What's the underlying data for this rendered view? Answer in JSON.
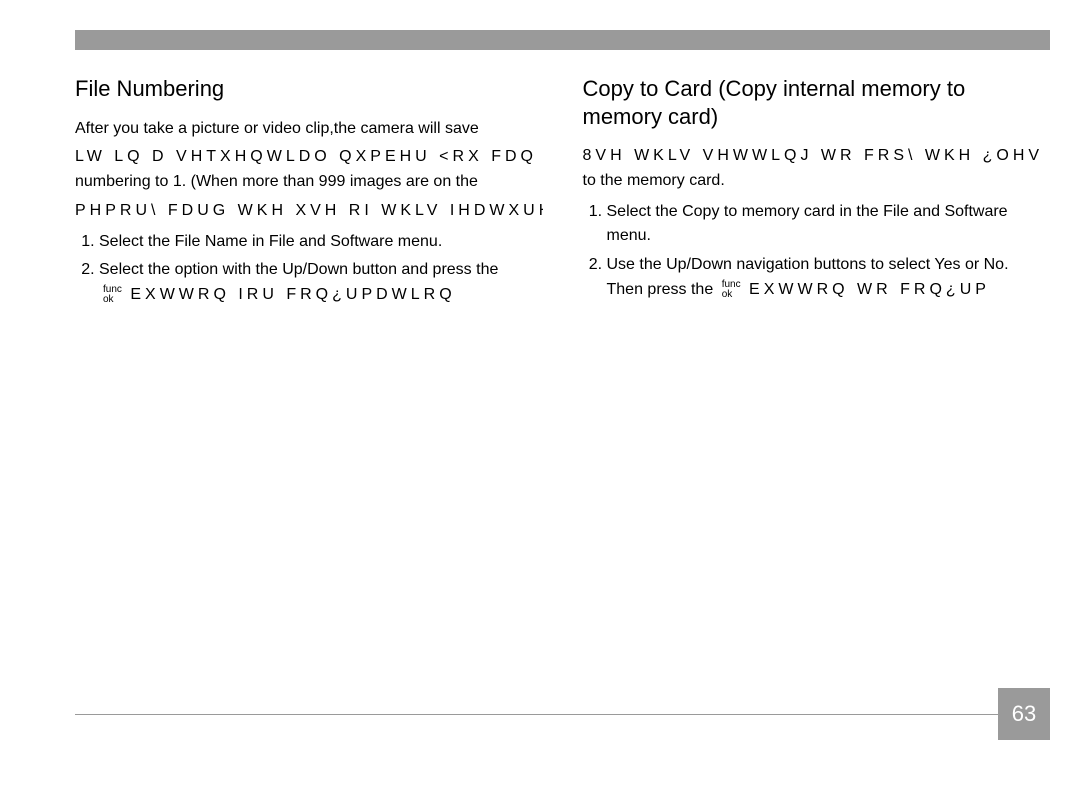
{
  "page_number": "63",
  "func_ok": {
    "top": "func",
    "bottom": "ok"
  },
  "left": {
    "heading": "File Numbering",
    "p1": "After you take a picture or video clip,the camera will save",
    "g1": "LW LQ D VHTXHQWLDO QXPEHU  <RX FDQ XVH WKLV WR UHVHW WKH ¿OH",
    "p2": "numbering to 1. (When more than 999 images are on the",
    "g2": "PHPRU\\ FDUG  WKH XVH RI WKLV IHDWXUH ZLOO KDYH QR HIIHFW",
    "li1": "Select the File Name in File and Software menu.",
    "li2_a": "Select the option with the Up/Down button and press the",
    "li2_g": "EXWWRQ IRU FRQ¿UPDWLRQ"
  },
  "right": {
    "heading": "Copy to Card (Copy internal memory to memory card)",
    "g1": "8VH WKLV VHWWLQJ WR FRS\\ WKH ¿OHV",
    "p1": "to the memory card.",
    "li1": "Select the Copy to memory card in the File and Software menu.",
    "li2_a": "Use the Up/Down navigation buttons to select Yes or No.",
    "li2_b": "Then press the",
    "li2_g": "EXWWRQ WR FRQ¿UP"
  }
}
